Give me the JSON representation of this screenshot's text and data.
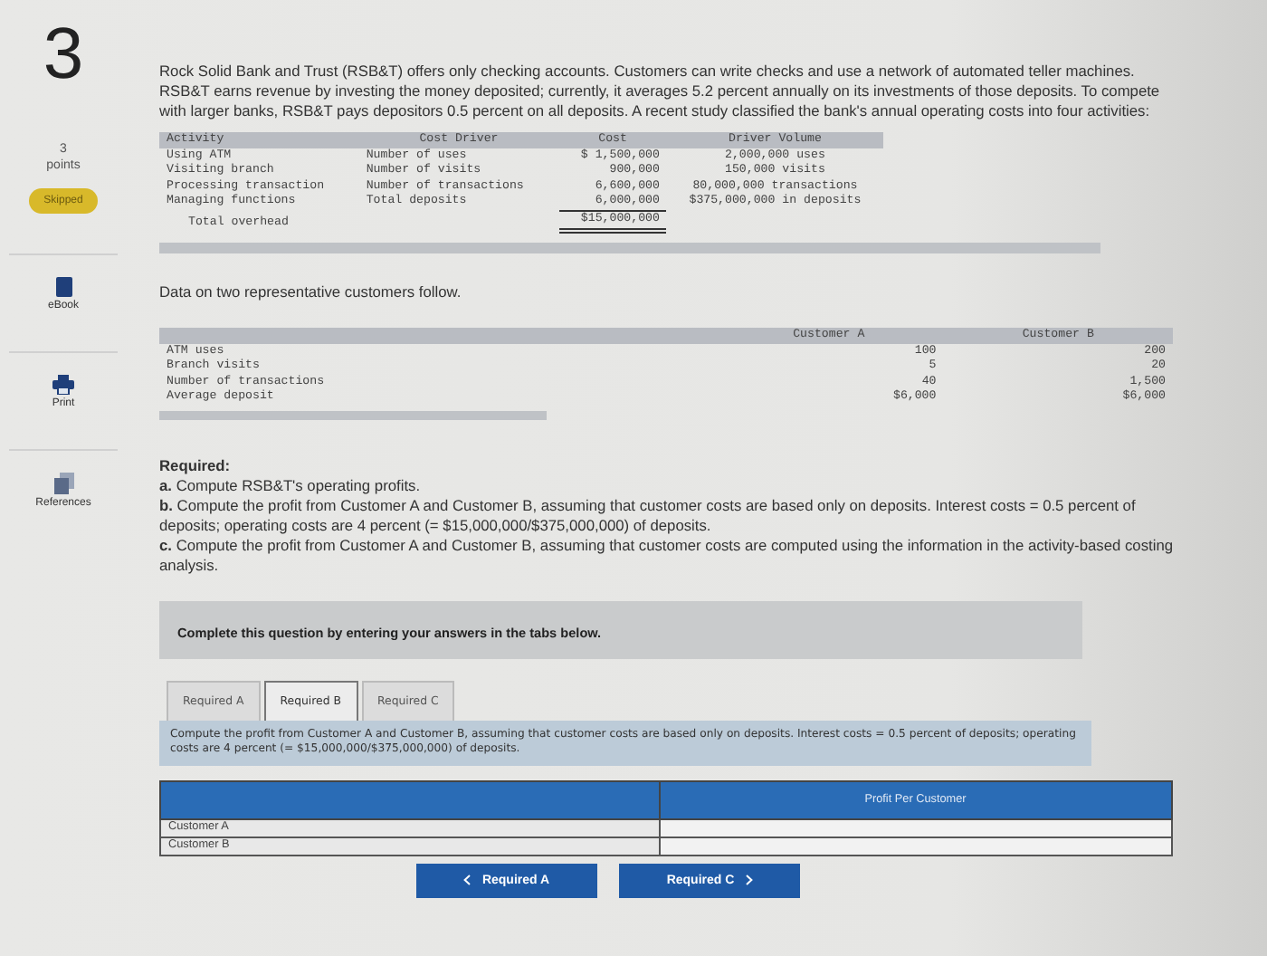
{
  "question": {
    "number": "3",
    "points": "3",
    "points_label": "points",
    "status": "Skipped"
  },
  "sidebar_tools": [
    {
      "kind": "ebook",
      "label": "eBook"
    },
    {
      "kind": "print",
      "label": "Print"
    },
    {
      "kind": "references",
      "label": "References"
    }
  ],
  "intro": "Rock Solid Bank and Trust (RSB&T) offers only checking accounts. Customers can write checks and use a network of automated teller machines. RSB&T earns revenue by investing the money deposited; currently, it averages 5.2 percent annually on its investments of those deposits. To compete with larger banks, RSB&T pays depositors 0.5 percent on all deposits. A recent study classified the bank's annual operating costs into four activities:",
  "activity_table": {
    "columns": [
      "Activity",
      "Cost Driver",
      "Cost",
      "Driver Volume"
    ],
    "rows": [
      [
        "Using ATM",
        "Number of uses",
        "$ 1,500,000",
        "2,000,000 uses"
      ],
      [
        "Visiting branch",
        "Number of visits",
        "900,000",
        "150,000 visits"
      ],
      [
        "Processing transaction",
        "Number of transactions",
        "6,600,000",
        "80,000,000 transactions"
      ],
      [
        "Managing functions",
        "Total deposits",
        "6,000,000",
        "$375,000,000 in deposits"
      ]
    ],
    "total_label": "Total overhead",
    "total_cost": "$15,000,000"
  },
  "customers_intro": "Data on two representative customers follow.",
  "customer_table": {
    "columns": [
      "Customer A",
      "Customer B"
    ],
    "rows": [
      {
        "label": "ATM uses",
        "values": [
          "100",
          "200"
        ]
      },
      {
        "label": "Branch visits",
        "values": [
          "5",
          "20"
        ]
      },
      {
        "label": "Number of transactions",
        "values": [
          "40",
          "1,500"
        ]
      },
      {
        "label": "Average deposit",
        "values": [
          "$6,000",
          "$6,000"
        ]
      }
    ]
  },
  "required": {
    "heading": "Required:",
    "items": [
      {
        "marker": "a.",
        "text": "Compute RSB&T's operating profits."
      },
      {
        "marker": "b.",
        "text": "Compute the profit from Customer A and Customer B, assuming that customer costs are based only on deposits. Interest costs = 0.5 percent of deposits; operating costs are 4 percent (= $15,000,000/$375,000,000) of deposits."
      },
      {
        "marker": "c.",
        "text": "Compute the profit from Customer A and Customer B, assuming that customer costs are computed using the information in the activity-based costing analysis."
      }
    ]
  },
  "instruction": "Complete this question by entering your answers in the tabs below.",
  "tabs": [
    {
      "label": "Required A",
      "selected": false
    },
    {
      "label": "Required B",
      "selected": true
    },
    {
      "label": "Required C",
      "selected": false
    }
  ],
  "tab_prompt": "Compute the profit from Customer A and Customer B, assuming that customer costs are based only on deposits. Interest costs = 0.5 percent of deposits; operating costs are 4 percent (= $15,000,000/$375,000,000) of deposits.",
  "answer_table": {
    "column": "Profit Per Customer",
    "rows": [
      {
        "label": "Customer A"
      },
      {
        "label": "Customer B"
      }
    ]
  },
  "nav_buttons": [
    {
      "kind": "prev",
      "label": "Required A"
    },
    {
      "kind": "next",
      "label": "Required C"
    }
  ]
}
